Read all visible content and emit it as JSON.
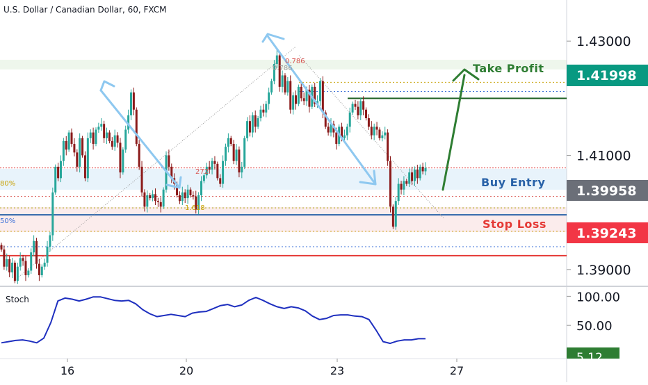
{
  "title": "U.S. Dollar / Canadian Dollar, 60, FXCM",
  "colors": {
    "bull": "#26a69a",
    "bear": "#8b1a1a",
    "stoch": "#1e2fbf",
    "take_profit": "#2e7d32",
    "buy_entry": "#2962a8",
    "stop_loss": "#e53935",
    "arrow": "#8ec8f0",
    "fib_gold": "#c8a000",
    "fib_red": "#d9534f",
    "fib_blue": "#3a6fd8"
  },
  "annotations": {
    "take_profit": "Take Profit",
    "buy_entry": "Buy Entry",
    "stop_loss": "Stop Loss"
  },
  "price_badges": {
    "take_profit": "1.41998",
    "buy_entry": "1.39958",
    "stop_loss": "1.39243"
  },
  "fib_labels": {
    "f786": "0.786",
    "f786b": "0.786",
    "f272": "272",
    "f1618": "1.618",
    "left_a": "80%",
    "left_b": "50%"
  },
  "stoch_badge": "5.12",
  "chart_data": [
    {
      "type": "candlestick",
      "title": "U.S. Dollar / Canadian Dollar, 60, FXCM",
      "y_ticks": [
        "1.43000",
        "1.41000",
        "1.39000"
      ],
      "x_ticks": [
        "16",
        "20",
        "23",
        "27"
      ],
      "ylim": [
        1.3873,
        1.4372
      ],
      "levels": {
        "take_profit": 1.41998,
        "buy_entry": 1.39958,
        "stop_loss": 1.39243,
        "current_price": 1.4078,
        "fib_0786": 1.4228,
        "fib_0786b": 1.4212,
        "fib_272": 1.4028,
        "fib_1618": 1.3967,
        "fib_left_80": 1.4008,
        "fib_left_50": 1.394
      },
      "closes": [
        1.3935,
        1.3905,
        1.3918,
        1.3895,
        1.3912,
        1.388,
        1.3905,
        1.392,
        1.3915,
        1.389,
        1.3898,
        1.393,
        1.395,
        1.391,
        1.389,
        1.3905,
        1.3912,
        1.394,
        1.396,
        1.4035,
        1.408,
        1.406,
        1.409,
        1.4125,
        1.411,
        1.414,
        1.412,
        1.4105,
        1.408,
        1.413,
        1.41,
        1.406,
        1.413,
        1.414,
        1.412,
        1.4145,
        1.415,
        1.4155,
        1.413,
        1.414,
        1.4125,
        1.4115,
        1.4135,
        1.4122,
        1.407,
        1.411,
        1.4145,
        1.417,
        1.421,
        1.418,
        1.412,
        1.408,
        1.4035,
        1.401,
        1.403,
        1.4025,
        1.4032,
        1.402,
        1.4018,
        1.401,
        1.404,
        1.41,
        1.408,
        1.406,
        1.405,
        1.403,
        1.402,
        1.4035,
        1.4025,
        1.404,
        1.403,
        1.4028,
        1.4005,
        1.403,
        1.4055,
        1.4065,
        1.408,
        1.4075,
        1.409,
        1.4085,
        1.406,
        1.405,
        1.409,
        1.4115,
        1.413,
        1.412,
        1.409,
        1.411,
        1.407,
        1.408,
        1.413,
        1.416,
        1.414,
        1.417,
        1.415,
        1.4165,
        1.418,
        1.4175,
        1.419,
        1.421,
        1.423,
        1.426,
        1.4275,
        1.422,
        1.424,
        1.421,
        1.423,
        1.418,
        1.4205,
        1.419,
        1.422,
        1.42,
        1.4195,
        1.4215,
        1.4185,
        1.422,
        1.419,
        1.4195,
        1.423,
        1.4175,
        1.415,
        1.414,
        1.4155,
        1.414,
        1.412,
        1.415,
        1.413,
        1.4135,
        1.415,
        1.4175,
        1.419,
        1.4185,
        1.417,
        1.4195,
        1.418,
        1.4165,
        1.415,
        1.4135,
        1.415,
        1.4145,
        1.413,
        1.4135,
        1.414,
        1.409,
        1.401,
        1.3975,
        1.402,
        1.405,
        1.404,
        1.4055,
        1.405,
        1.407,
        1.4055,
        1.4075,
        1.406,
        1.408,
        1.4072,
        1.4078
      ],
      "stochastic": {
        "y_ticks": [
          "100.00",
          "50.00"
        ],
        "ylim": [
          0,
          110
        ],
        "values": [
          20,
          22,
          24,
          25,
          23,
          20,
          28,
          55,
          92,
          97,
          95,
          92,
          95,
          99,
          99,
          96,
          93,
          92,
          93,
          87,
          77,
          70,
          65,
          67,
          69,
          67,
          65,
          71,
          73,
          74,
          79,
          84,
          86,
          82,
          85,
          93,
          98,
          93,
          87,
          82,
          79,
          82,
          80,
          75,
          66,
          60,
          62,
          67,
          68,
          68,
          66,
          65,
          60,
          42,
          22,
          19,
          23,
          25,
          25,
          27,
          27
        ]
      }
    }
  ]
}
